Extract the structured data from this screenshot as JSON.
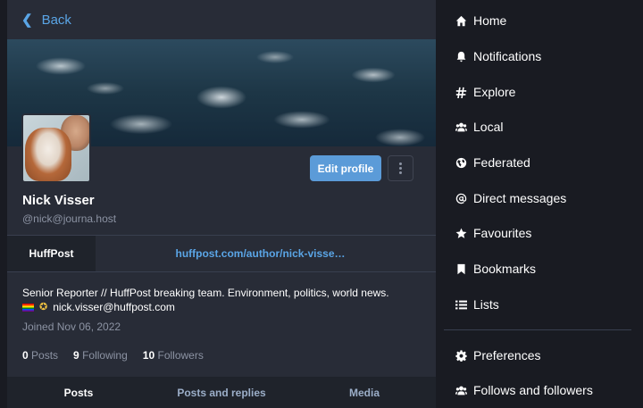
{
  "back": {
    "label": "Back"
  },
  "profile": {
    "display_name": "Nick Visser",
    "acct": "@nick@journa.host",
    "edit_label": "Edit profile",
    "field": {
      "name": "HuffPost",
      "value": "huffpost.com/author/nick-visse…"
    },
    "bio_line1": "Senior Reporter // HuffPost breaking team. Environment, politics, world news.",
    "bio_email": "nick.visser@huffpost.com",
    "joined": "Joined Nov 06, 2022",
    "counts": {
      "posts_num": "0",
      "posts_label": "Posts",
      "following_num": "9",
      "following_label": "Following",
      "followers_num": "10",
      "followers_label": "Followers"
    }
  },
  "tabs": [
    "Posts",
    "Posts and replies",
    "Media"
  ],
  "nav": [
    {
      "label": "Home",
      "icon": "home-icon"
    },
    {
      "label": "Notifications",
      "icon": "bell-icon"
    },
    {
      "label": "Explore",
      "icon": "hashtag-icon"
    },
    {
      "label": "Local",
      "icon": "users-icon"
    },
    {
      "label": "Federated",
      "icon": "globe-icon"
    },
    {
      "label": "Direct messages",
      "icon": "at-icon"
    },
    {
      "label": "Favourites",
      "icon": "star-icon"
    },
    {
      "label": "Bookmarks",
      "icon": "bookmark-icon"
    },
    {
      "label": "Lists",
      "icon": "list-icon"
    },
    {
      "label": "Preferences",
      "icon": "gear-icon"
    },
    {
      "label": "Follows and followers",
      "icon": "users-icon"
    }
  ],
  "colors": {
    "accent": "#5b9bd8",
    "link": "#5aa5e6",
    "panel": "#282c37",
    "background": "#191b22"
  }
}
